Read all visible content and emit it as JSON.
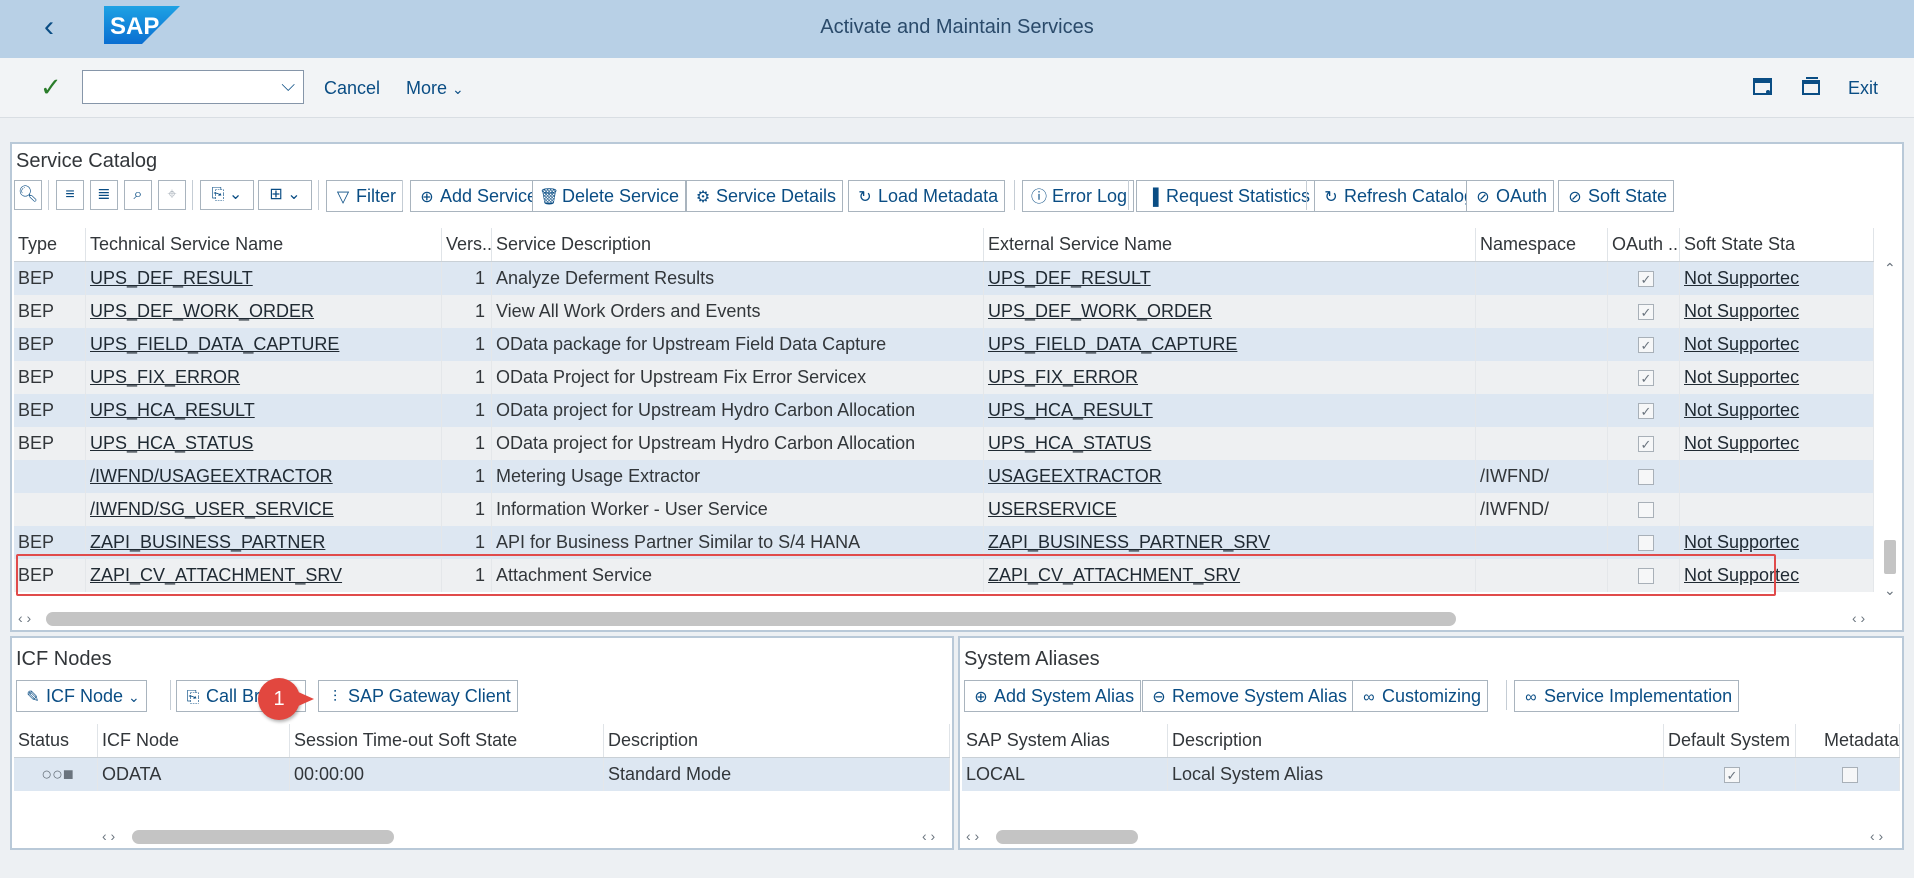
{
  "shell": {
    "title": "Activate and Maintain Services",
    "logo_text": "SAP",
    "back_icon": "chevron-left-icon"
  },
  "toolbar": {
    "cancel_label": "Cancel",
    "more_label": "More",
    "exit_label": "Exit",
    "command_value": ""
  },
  "catalog": {
    "title": "Service Catalog",
    "buttons": {
      "filter": "Filter",
      "add_service": "Add Service",
      "delete_service": "Delete Service",
      "service_details": "Service Details",
      "load_metadata": "Load Metadata",
      "error_log": "Error Log",
      "request_statistics": "Request Statistics",
      "refresh_catalog": "Refresh Catalog",
      "oauth": "OAuth",
      "soft_state": "Soft State"
    },
    "columns": [
      "Type",
      "Technical Service Name",
      "Vers...",
      "Service Description",
      "External Service Name",
      "Namespace",
      "OAuth ...",
      "Soft State Sta"
    ],
    "rows": [
      {
        "type": "BEP",
        "tech": "UPS_DEF_RESULT",
        "ver": "1",
        "desc": "Analyze Deferment Results",
        "ext": "UPS_DEF_RESULT",
        "ns": "",
        "oauth": true,
        "soft": "Not Supportec"
      },
      {
        "type": "BEP",
        "tech": "UPS_DEF_WORK_ORDER",
        "ver": "1",
        "desc": "View All Work Orders and Events",
        "ext": "UPS_DEF_WORK_ORDER",
        "ns": "",
        "oauth": true,
        "soft": "Not Supportec"
      },
      {
        "type": "BEP",
        "tech": "UPS_FIELD_DATA_CAPTURE",
        "ver": "1",
        "desc": "OData package for Upstream Field Data Capture",
        "ext": "UPS_FIELD_DATA_CAPTURE",
        "ns": "",
        "oauth": true,
        "soft": "Not Supportec"
      },
      {
        "type": "BEP",
        "tech": "UPS_FIX_ERROR",
        "ver": "1",
        "desc": "OData Project for Upstream Fix Error Servicex",
        "ext": "UPS_FIX_ERROR",
        "ns": "",
        "oauth": true,
        "soft": "Not Supportec"
      },
      {
        "type": "BEP",
        "tech": "UPS_HCA_RESULT",
        "ver": "1",
        "desc": "OData project for Upstream Hydro Carbon Allocation",
        "ext": "UPS_HCA_RESULT",
        "ns": "",
        "oauth": true,
        "soft": "Not Supportec"
      },
      {
        "type": "BEP",
        "tech": "UPS_HCA_STATUS",
        "ver": "1",
        "desc": "OData project for Upstream Hydro Carbon Allocation",
        "ext": "UPS_HCA_STATUS",
        "ns": "",
        "oauth": true,
        "soft": "Not Supportec"
      },
      {
        "type": "",
        "tech": "/IWFND/USAGEEXTRACTOR",
        "ver": "1",
        "desc": "Metering Usage Extractor",
        "ext": "USAGEEXTRACTOR",
        "ns": "/IWFND/",
        "oauth": false,
        "soft": ""
      },
      {
        "type": "",
        "tech": "/IWFND/SG_USER_SERVICE",
        "ver": "1",
        "desc": "Information Worker - User Service",
        "ext": "USERSERVICE",
        "ns": "/IWFND/",
        "oauth": false,
        "soft": ""
      },
      {
        "type": "BEP",
        "tech": "ZAPI_BUSINESS_PARTNER",
        "ver": "1",
        "desc": "API for Business Partner Similar to S/4 HANA",
        "ext": "ZAPI_BUSINESS_PARTNER_SRV",
        "ns": "",
        "oauth": false,
        "soft": "Not Supportec"
      },
      {
        "type": "BEP",
        "tech": "ZAPI_CV_ATTACHMENT_SRV",
        "ver": "1",
        "desc": "Attachment Service",
        "ext": "ZAPI_CV_ATTACHMENT_SRV",
        "ns": "",
        "oauth": false,
        "soft": "Not Supportec"
      }
    ]
  },
  "icf": {
    "title": "ICF Nodes",
    "buttons": {
      "icf_node": "ICF Node",
      "call_browser": "Call Bro",
      "gateway_client": "SAP Gateway Client"
    },
    "columns": [
      "Status",
      "ICF Node",
      "Session Time-out Soft State",
      "Description"
    ],
    "rows": [
      {
        "status": "○○■",
        "node": "ODATA",
        "timeout": "00:00:00",
        "desc": "Standard Mode"
      }
    ]
  },
  "aliases": {
    "title": "System Aliases",
    "buttons": {
      "add_alias": "Add System Alias",
      "remove_alias": "Remove System Alias",
      "customizing": "Customizing",
      "service_impl": "Service Implementation"
    },
    "columns": [
      "SAP System Alias",
      "Description",
      "Default System",
      "Metadata"
    ],
    "rows": [
      {
        "alias": "LOCAL",
        "desc": "Local System Alias",
        "default": true,
        "metadata": false
      }
    ]
  },
  "annotation": {
    "badge": "1"
  },
  "colors": {
    "shell": "#b8d0e6",
    "accent": "#0a4d84",
    "highlight": "#e04b4b"
  }
}
